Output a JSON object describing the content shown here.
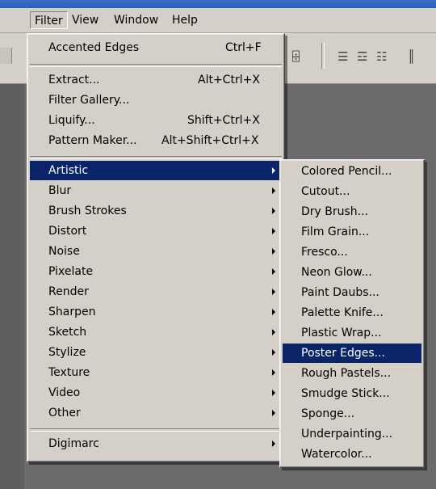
{
  "menubar": {
    "items": [
      {
        "label": "Filter"
      },
      {
        "label": "View"
      },
      {
        "label": "Window"
      },
      {
        "label": "Help"
      }
    ]
  },
  "toolbar": {
    "icons": [
      "align-bottom-edges-icon",
      "distribute-top-icon",
      "distribute-vcenter-icon",
      "distribute-bottom-icon",
      "distribute-left-icon"
    ],
    "glyphs": [
      "⌹",
      "☰",
      "☲",
      "☷",
      "║"
    ]
  },
  "filter_menu": {
    "last_filter": {
      "label": "Accented Edges",
      "shortcut": "Ctrl+F"
    },
    "group2": [
      {
        "label": "Extract...",
        "shortcut": "Alt+Ctrl+X"
      },
      {
        "label": "Filter Gallery...",
        "shortcut": ""
      },
      {
        "label": "Liquify...",
        "shortcut": "Shift+Ctrl+X"
      },
      {
        "label": "Pattern Maker...",
        "shortcut": "Alt+Shift+Ctrl+X"
      }
    ],
    "categories": [
      {
        "label": "Artistic"
      },
      {
        "label": "Blur"
      },
      {
        "label": "Brush Strokes"
      },
      {
        "label": "Distort"
      },
      {
        "label": "Noise"
      },
      {
        "label": "Pixelate"
      },
      {
        "label": "Render"
      },
      {
        "label": "Sharpen"
      },
      {
        "label": "Sketch"
      },
      {
        "label": "Stylize"
      },
      {
        "label": "Texture"
      },
      {
        "label": "Video"
      },
      {
        "label": "Other"
      }
    ],
    "digimarc": {
      "label": "Digimarc"
    }
  },
  "artistic_submenu": {
    "items": [
      {
        "label": "Colored Pencil..."
      },
      {
        "label": "Cutout..."
      },
      {
        "label": "Dry Brush..."
      },
      {
        "label": "Film Grain..."
      },
      {
        "label": "Fresco..."
      },
      {
        "label": "Neon Glow..."
      },
      {
        "label": "Paint Daubs..."
      },
      {
        "label": "Palette Knife..."
      },
      {
        "label": "Plastic Wrap..."
      },
      {
        "label": "Poster Edges..."
      },
      {
        "label": "Rough Pastels..."
      },
      {
        "label": "Smudge Stick..."
      },
      {
        "label": "Sponge..."
      },
      {
        "label": "Underpainting..."
      },
      {
        "label": "Watercolor..."
      }
    ]
  },
  "colors": {
    "menu_bg": "#d4d0c8",
    "highlight": "#0a246a",
    "highlight_text": "#ffffff",
    "workspace": "#6b6b6b"
  }
}
